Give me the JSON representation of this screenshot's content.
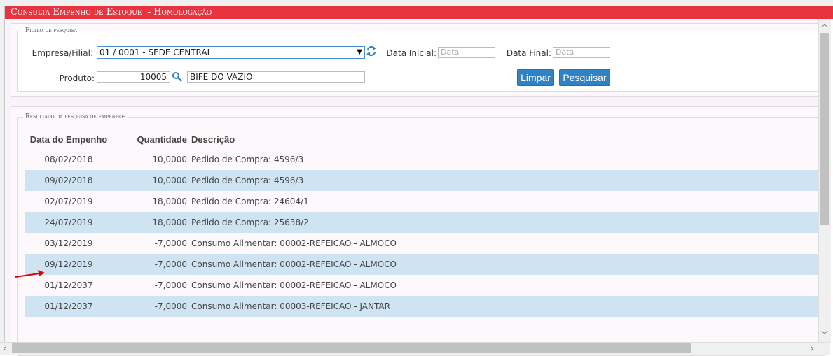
{
  "window": {
    "title": "Consulta Empenho de Estoque  - Homologação"
  },
  "filter": {
    "legend": "Filtro de pesquisa",
    "empresa_label": "Empresa/Filial:",
    "empresa_value": "01 / 0001 - SEDE CENTRAL",
    "data_inicial_label": "Data Inicial:",
    "data_inicial_placeholder": "Data",
    "data_final_label": "Data Final:",
    "data_final_placeholder": "Data",
    "produto_label": "Produto:",
    "produto_code": "10005",
    "produto_desc": "BIFE DO VAZIO",
    "limpar_label": "Limpar",
    "pesquisar_label": "Pesquisar"
  },
  "results": {
    "legend": "Resultado da pesquisa de empenhos",
    "headers": [
      "Data do Empenho",
      "Quantidade",
      "Descrição"
    ],
    "rows": [
      {
        "data": "08/02/2018",
        "quantidade": "10,0000",
        "descricao": "Pedido de Compra: 4596/3"
      },
      {
        "data": "09/02/2018",
        "quantidade": "10,0000",
        "descricao": "Pedido de Compra: 4596/3"
      },
      {
        "data": "02/07/2019",
        "quantidade": "18,0000",
        "descricao": "Pedido de Compra: 24604/1"
      },
      {
        "data": "24/07/2019",
        "quantidade": "18,0000",
        "descricao": "Pedido de Compra: 25638/2"
      },
      {
        "data": "03/12/2019",
        "quantidade": "-7,0000",
        "descricao": "Consumo Alimentar: 00002-REFEICAO - ALMOCO"
      },
      {
        "data": "09/12/2019",
        "quantidade": "-7,0000",
        "descricao": "Consumo Alimentar: 00002-REFEICAO - ALMOCO"
      },
      {
        "data": "01/12/2037",
        "quantidade": "-7,0000",
        "descricao": "Consumo Alimentar: 00002-REFEICAO - ALMOCO"
      },
      {
        "data": "01/12/2037",
        "quantidade": "-7,0000",
        "descricao": "Consumo Alimentar: 00003-REFEICAO - JANTAR"
      }
    ]
  },
  "icons": {
    "dropdown": "chevron-down-icon",
    "refresh": "refresh-icon",
    "search": "search-icon",
    "annotation": "red-arrow-icon"
  },
  "colors": {
    "title_bar": "#e8343f",
    "button": "#2f83c4",
    "row_alt": "#cfe4f3"
  }
}
